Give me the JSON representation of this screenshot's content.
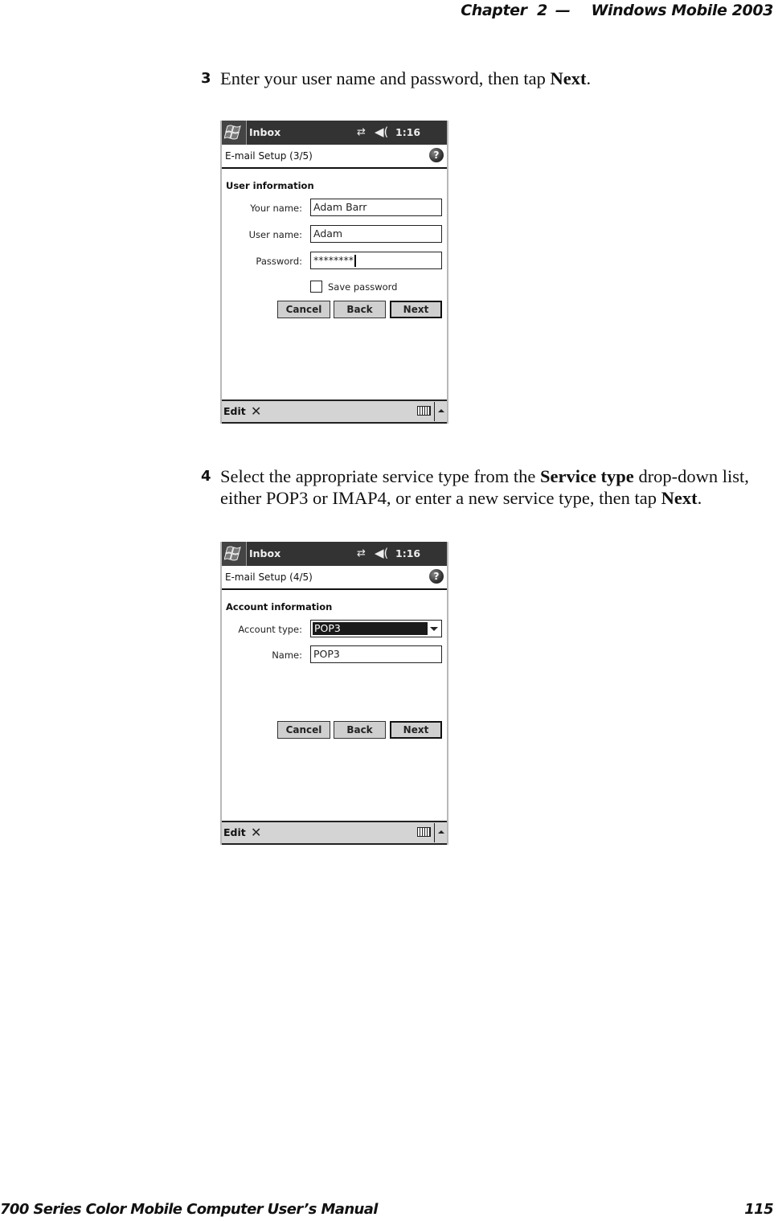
{
  "running_head": {
    "chapter": "Chapter  2",
    "separator": "—",
    "title": "Windows Mobile 2003"
  },
  "steps": [
    {
      "number": "3",
      "text_before": "Enter your user name and password, then tap ",
      "bold": "Next",
      "text_after": "."
    },
    {
      "number": "4",
      "text_before": "Select the appropriate service type from the ",
      "bold": "Service type",
      "text_middle": " drop-down list, either POP3 or IMAP4, or enter a new service type, then tap ",
      "bold2": "Next",
      "text_after": "."
    }
  ],
  "screens": [
    {
      "titlebar": {
        "app": "Inbox",
        "time": "1:16"
      },
      "header": "E-mail Setup (3/5)",
      "section": "User information",
      "fields": [
        {
          "label": "Your name:",
          "value": "Adam Barr"
        },
        {
          "label": "User name:",
          "value": "Adam"
        },
        {
          "label": "Password:",
          "value": "********"
        }
      ],
      "checkbox": {
        "label": "Save password",
        "checked": false
      },
      "buttons": {
        "cancel": "Cancel",
        "back": "Back",
        "next": "Next"
      },
      "menubar": {
        "edit": "Edit"
      }
    },
    {
      "titlebar": {
        "app": "Inbox",
        "time": "1:16"
      },
      "header": "E-mail Setup (4/5)",
      "section": "Account information",
      "account_type": {
        "label": "Account type:",
        "selected": "POP3"
      },
      "name": {
        "label": "Name:",
        "value": "POP3"
      },
      "buttons": {
        "cancel": "Cancel",
        "back": "Back",
        "next": "Next"
      },
      "menubar": {
        "edit": "Edit"
      }
    }
  ],
  "icons": {
    "start": "windows-flag-icon",
    "connectivity": "⇄",
    "volume": "◀(",
    "help": "?",
    "tools": "✕"
  },
  "footer": {
    "manual_title": "700 Series Color Mobile Computer User’s Manual",
    "page_number": "115"
  }
}
